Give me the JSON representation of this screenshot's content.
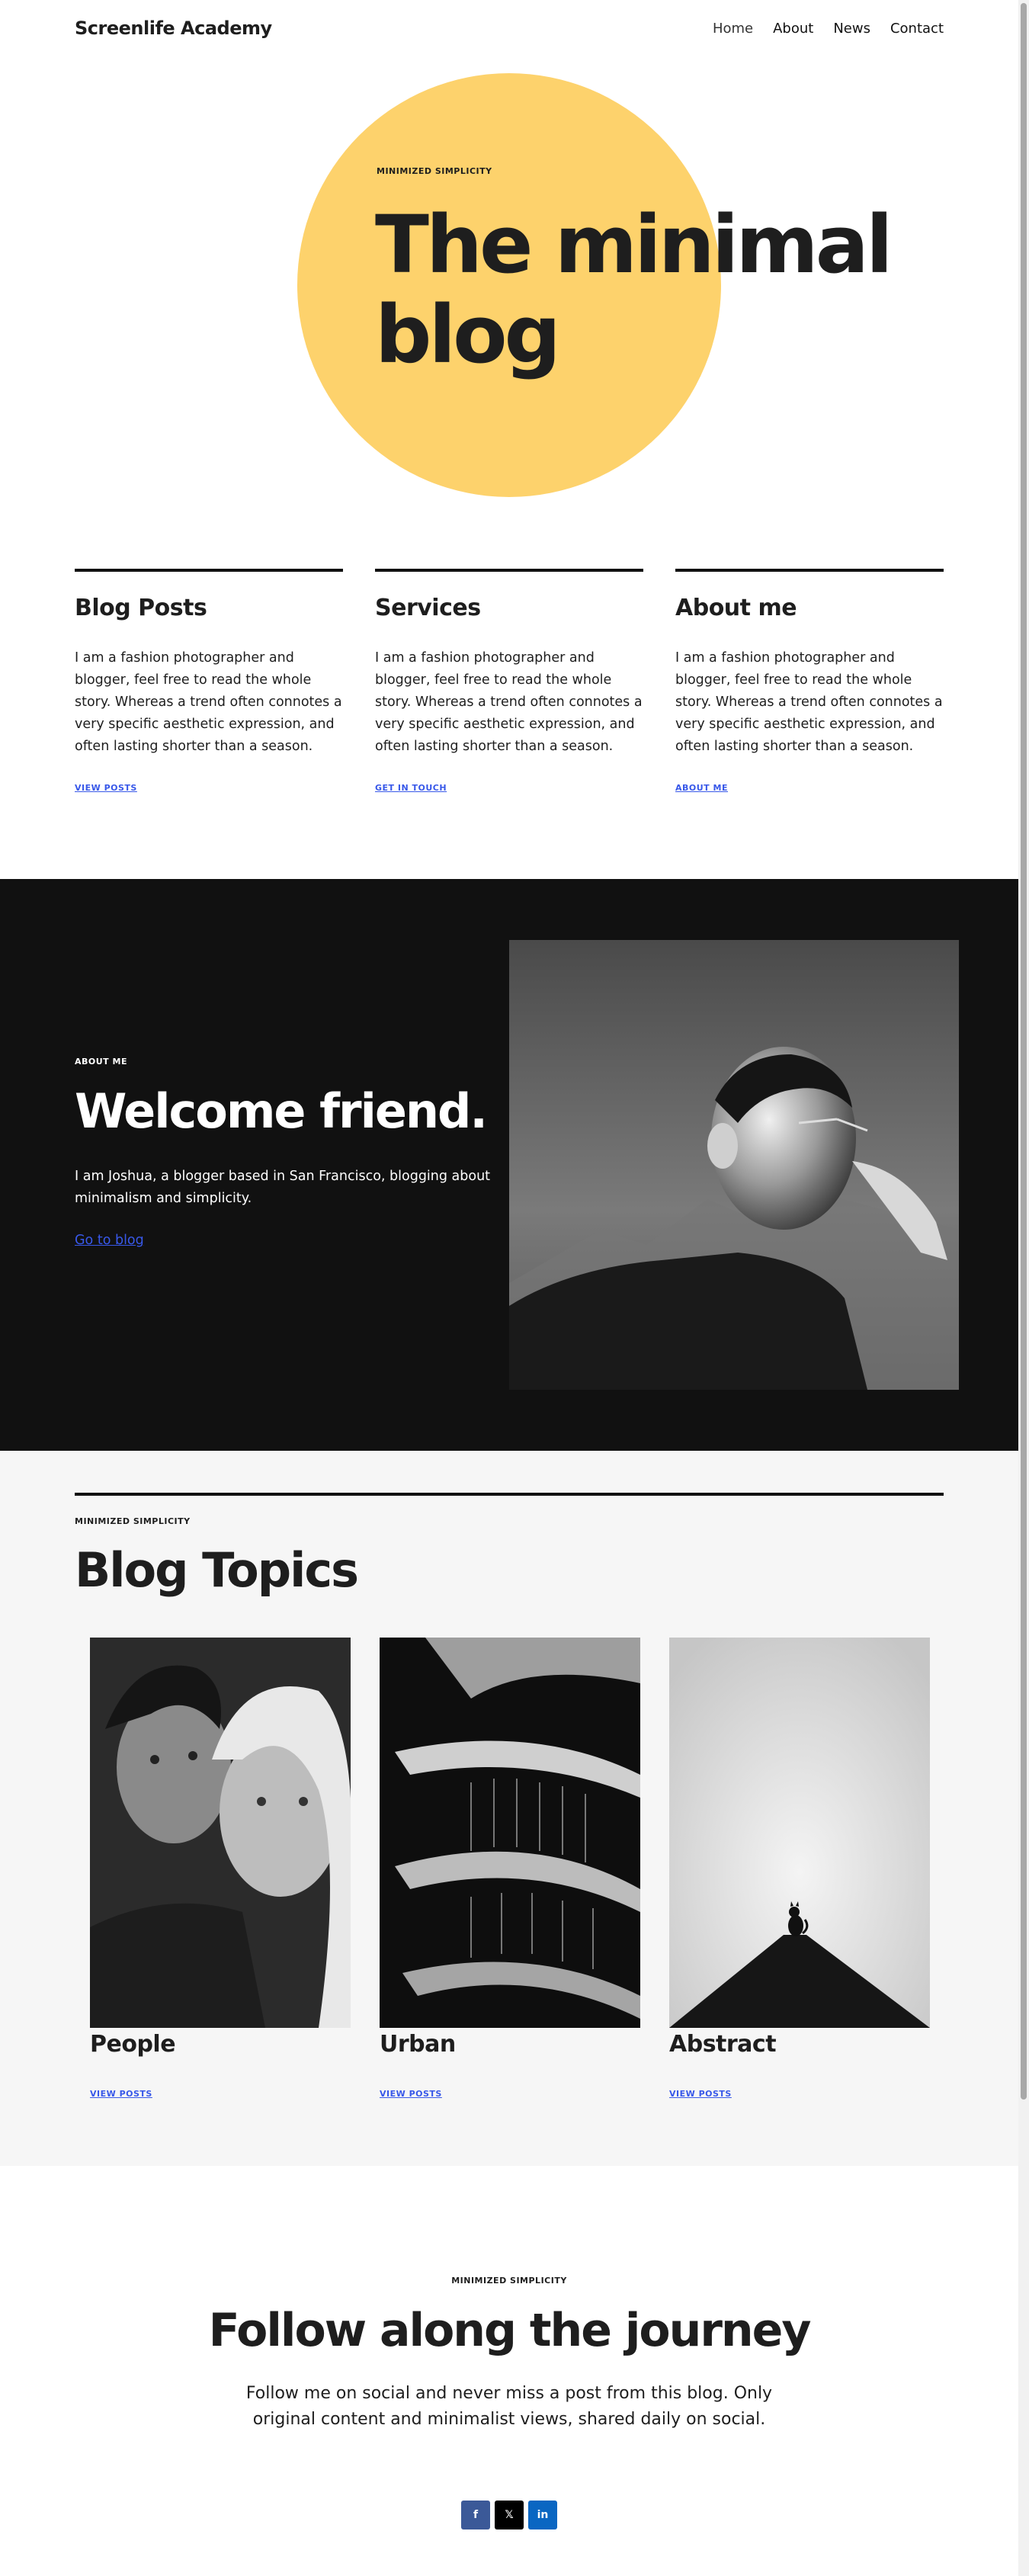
{
  "header": {
    "site_title": "Screenlife Academy",
    "nav": [
      "Home",
      "About",
      "News",
      "Contact"
    ]
  },
  "hero": {
    "eyebrow": "MINIMIZED SIMPLICITY",
    "title_line1": "The minimal",
    "title_line2": "blog",
    "circle_color": "#fdd26c"
  },
  "columns": [
    {
      "title": "Blog Posts",
      "text": "I am a fashion photographer and blogger, feel free to read the whole story. Whereas a trend often connotes a very specific aesthetic expression, and often lasting shorter than a season.",
      "link": "VIEW POSTS"
    },
    {
      "title": "Services",
      "text": "I am a fashion photographer and blogger, feel free to read the whole story. Whereas a trend often connotes a very specific aesthetic expression, and often lasting shorter than a season.",
      "link": "GET IN TOUCH"
    },
    {
      "title": "About me",
      "text": "I am a fashion photographer and blogger, feel free to read the whole story. Whereas a trend often connotes a very specific aesthetic expression, and often lasting shorter than a season.",
      "link": "ABOUT ME"
    }
  ],
  "about": {
    "eyebrow": "ABOUT ME",
    "title": "Welcome friend.",
    "text": "I am Joshua, a blogger based in San Francisco, blogging about minimalism and simplicity.",
    "link": "Go to blog"
  },
  "topics": {
    "eyebrow": "MINIMIZED SIMPLICITY",
    "title": "Blog Topics",
    "items": [
      {
        "name": "People",
        "link": "VIEW POSTS"
      },
      {
        "name": "Urban",
        "link": "VIEW POSTS"
      },
      {
        "name": "Abstract",
        "link": "VIEW POSTS"
      }
    ]
  },
  "follow": {
    "eyebrow": "MINIMIZED SIMPLICITY",
    "title": "Follow along the journey",
    "text": "Follow me on social and never miss a post from this blog. Only original content and minimalist views, shared daily on social.",
    "social": [
      {
        "icon": "facebook-icon",
        "glyph": "f"
      },
      {
        "icon": "x-icon",
        "glyph": "𝕏"
      },
      {
        "icon": "linkedin-icon",
        "glyph": "in"
      }
    ]
  },
  "colors": {
    "link": "#3858e9",
    "dark": "#111111",
    "light_bg": "#f6f6f6"
  }
}
